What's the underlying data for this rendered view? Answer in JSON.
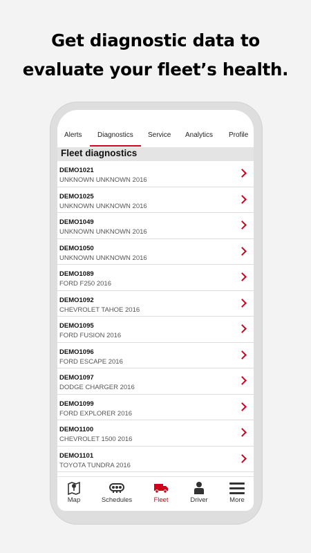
{
  "headline": {
    "line1": "Get diagnostic data to",
    "line2": "evaluate your fleet’s health."
  },
  "tabs": [
    {
      "label": "Alerts",
      "active": false
    },
    {
      "label": "Diagnostics",
      "active": true
    },
    {
      "label": "Service",
      "active": false
    },
    {
      "label": "Analytics",
      "active": false
    },
    {
      "label": "Profile",
      "active": false
    }
  ],
  "section": {
    "title": "Fleet diagnostics"
  },
  "vehicles": [
    {
      "id": "DEMO1021",
      "desc": "UNKNOWN UNKNOWN 2016"
    },
    {
      "id": "DEMO1025",
      "desc": "UNKNOWN UNKNOWN 2016"
    },
    {
      "id": "DEMO1049",
      "desc": "UNKNOWN UNKNOWN 2016"
    },
    {
      "id": "DEMO1050",
      "desc": "UNKNOWN UNKNOWN 2016"
    },
    {
      "id": "DEMO1089",
      "desc": "FORD F250 2016"
    },
    {
      "id": "DEMO1092",
      "desc": "CHEVROLET TAHOE 2016"
    },
    {
      "id": "DEMO1095",
      "desc": "FORD FUSION 2016"
    },
    {
      "id": "DEMO1096",
      "desc": "FORD ESCAPE 2016"
    },
    {
      "id": "DEMO1097",
      "desc": "DODGE CHARGER 2016"
    },
    {
      "id": "DEMO1099",
      "desc": "FORD EXPLORER 2016"
    },
    {
      "id": "DEMO1100",
      "desc": "CHEVROLET 1500 2016"
    },
    {
      "id": "DEMO1101",
      "desc": "TOYOTA TUNDRA 2016"
    }
  ],
  "nav": [
    {
      "label": "Map",
      "icon": "map-icon",
      "active": false
    },
    {
      "label": "Schedules",
      "icon": "schedules-icon",
      "active": false
    },
    {
      "label": "Fleet",
      "icon": "truck-icon",
      "active": true
    },
    {
      "label": "Driver",
      "icon": "driver-icon",
      "active": false
    },
    {
      "label": "More",
      "icon": "menu-icon",
      "active": false
    }
  ],
  "colors": {
    "accent": "#d0021b",
    "section_bg": "#e4e4e4",
    "phone_frame": "#dedede",
    "page_bg": "#f3f3f3"
  }
}
